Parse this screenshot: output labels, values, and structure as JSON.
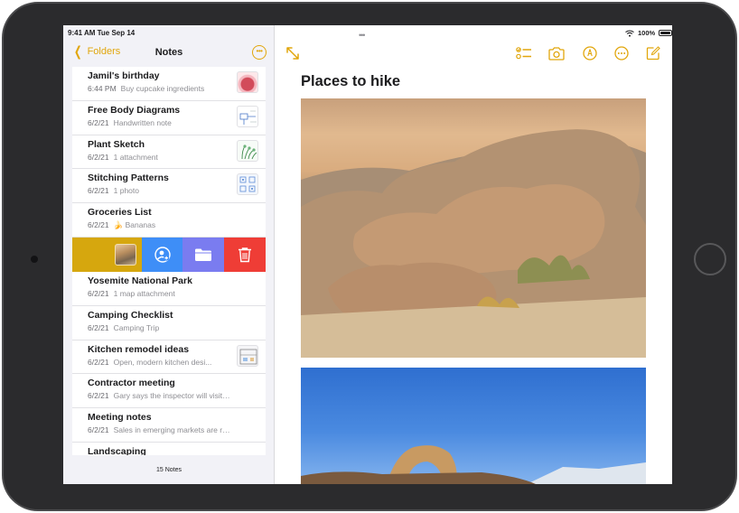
{
  "status": {
    "time_date": "9:41 AM  Tue Sep 14",
    "battery": "100%"
  },
  "sidebar": {
    "back_label": "Folders",
    "title": "Notes",
    "more_label": "•••",
    "footer": "15 Notes",
    "notes": [
      {
        "title": "Jamil's birthday",
        "date": "6:44 PM",
        "preview": "Buy cupcake ingredients",
        "thumb": "cake-photo"
      },
      {
        "title": "Free Body Diagrams",
        "date": "6/2/21",
        "preview": "Handwritten note",
        "thumb": "diagram-sketch"
      },
      {
        "title": "Plant Sketch",
        "date": "6/2/21",
        "preview": "1 attachment",
        "thumb": "plant-sketch"
      },
      {
        "title": "Stitching Patterns",
        "date": "6/2/21",
        "preview": "1 photo",
        "thumb": "stitch-pattern"
      },
      {
        "title": "Groceries List",
        "date": "6/2/21",
        "preview": "🍌 Bananas"
      },
      {
        "title": "Yosemite National Park",
        "date": "6/2/21",
        "preview": "1 map attachment"
      },
      {
        "title": "Camping Checklist",
        "date": "6/2/21",
        "preview": "Camping Trip"
      },
      {
        "title": "Kitchen remodel ideas",
        "date": "6/2/21",
        "preview": "Open, modern kitchen desi...",
        "thumb": "kitchen-plan"
      },
      {
        "title": "Contractor meeting",
        "date": "6/2/21",
        "preview": "Gary says the inspector will visit n..."
      },
      {
        "title": "Meeting notes",
        "date": "6/2/21",
        "preview": "Sales in emerging markets are ren..."
      },
      {
        "title": "Landscaping",
        "date": "",
        "preview": ""
      }
    ]
  },
  "swipe_actions": {
    "icons": [
      "share-person-icon",
      "folder-icon",
      "trash-icon"
    ],
    "colors": {
      "note": "#d6a70e",
      "share": "#3e8ef7",
      "move": "#7a7cf0",
      "delete": "#ef3d36"
    }
  },
  "detail": {
    "note_title": "Places to hike",
    "toolbar_icons": [
      "expand-icon",
      "checklist-icon",
      "camera-icon",
      "markup-pen-icon",
      "more-icon",
      "compose-icon"
    ]
  },
  "colors": {
    "accent": "#e1a60c",
    "background": "#f2f2f7",
    "device_frame": "#2b2b2d"
  }
}
